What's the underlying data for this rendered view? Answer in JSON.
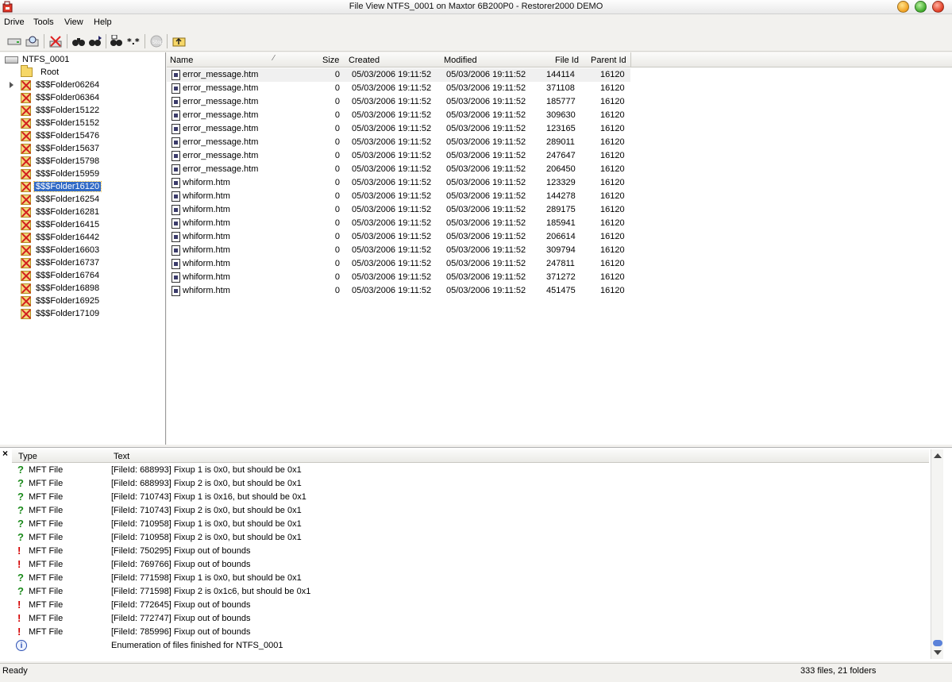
{
  "window": {
    "title": "File View NTFS_0001 on Maxtor 6B200P0 - Restorer2000 DEMO"
  },
  "menu": [
    "Drive",
    "Tools",
    "View",
    "Help"
  ],
  "toolbar": {
    "buttons": [
      "drive-icon",
      "search-scan-icon",
      "disconnect-icon",
      "find-icon",
      "find-next-icon",
      "find-file-icon",
      "mask-icon",
      "stop-icon",
      "up-folder-icon"
    ]
  },
  "tree": {
    "root": "NTFS_0001",
    "root_folder": "Root",
    "selected": "$$$Folder16120",
    "folders": [
      "$$$Folder06264",
      "$$$Folder06364",
      "$$$Folder15122",
      "$$$Folder15152",
      "$$$Folder15476",
      "$$$Folder15637",
      "$$$Folder15798",
      "$$$Folder15959",
      "$$$Folder16120",
      "$$$Folder16254",
      "$$$Folder16281",
      "$$$Folder16415",
      "$$$Folder16442",
      "$$$Folder16603",
      "$$$Folder16737",
      "$$$Folder16764",
      "$$$Folder16898",
      "$$$Folder16925",
      "$$$Folder17109"
    ]
  },
  "files": {
    "columns": {
      "name": "Name",
      "size": "Size",
      "created": "Created",
      "modified": "Modified",
      "file_id": "File Id",
      "parent_id": "Parent Id"
    },
    "rows": [
      {
        "name": "error_message.htm",
        "size": "0",
        "created": "05/03/2006 19:11:52",
        "modified": "05/03/2006 19:11:52",
        "file_id": "144114",
        "parent_id": "16120"
      },
      {
        "name": "error_message.htm",
        "size": "0",
        "created": "05/03/2006 19:11:52",
        "modified": "05/03/2006 19:11:52",
        "file_id": "371108",
        "parent_id": "16120"
      },
      {
        "name": "error_message.htm",
        "size": "0",
        "created": "05/03/2006 19:11:52",
        "modified": "05/03/2006 19:11:52",
        "file_id": "185777",
        "parent_id": "16120"
      },
      {
        "name": "error_message.htm",
        "size": "0",
        "created": "05/03/2006 19:11:52",
        "modified": "05/03/2006 19:11:52",
        "file_id": "309630",
        "parent_id": "16120"
      },
      {
        "name": "error_message.htm",
        "size": "0",
        "created": "05/03/2006 19:11:52",
        "modified": "05/03/2006 19:11:52",
        "file_id": "123165",
        "parent_id": "16120"
      },
      {
        "name": "error_message.htm",
        "size": "0",
        "created": "05/03/2006 19:11:52",
        "modified": "05/03/2006 19:11:52",
        "file_id": "289011",
        "parent_id": "16120"
      },
      {
        "name": "error_message.htm",
        "size": "0",
        "created": "05/03/2006 19:11:52",
        "modified": "05/03/2006 19:11:52",
        "file_id": "247647",
        "parent_id": "16120"
      },
      {
        "name": "error_message.htm",
        "size": "0",
        "created": "05/03/2006 19:11:52",
        "modified": "05/03/2006 19:11:52",
        "file_id": "206450",
        "parent_id": "16120"
      },
      {
        "name": "whiform.htm",
        "size": "0",
        "created": "05/03/2006 19:11:52",
        "modified": "05/03/2006 19:11:52",
        "file_id": "123329",
        "parent_id": "16120"
      },
      {
        "name": "whiform.htm",
        "size": "0",
        "created": "05/03/2006 19:11:52",
        "modified": "05/03/2006 19:11:52",
        "file_id": "144278",
        "parent_id": "16120"
      },
      {
        "name": "whiform.htm",
        "size": "0",
        "created": "05/03/2006 19:11:52",
        "modified": "05/03/2006 19:11:52",
        "file_id": "289175",
        "parent_id": "16120"
      },
      {
        "name": "whiform.htm",
        "size": "0",
        "created": "05/03/2006 19:11:52",
        "modified": "05/03/2006 19:11:52",
        "file_id": "185941",
        "parent_id": "16120"
      },
      {
        "name": "whiform.htm",
        "size": "0",
        "created": "05/03/2006 19:11:52",
        "modified": "05/03/2006 19:11:52",
        "file_id": "206614",
        "parent_id": "16120"
      },
      {
        "name": "whiform.htm",
        "size": "0",
        "created": "05/03/2006 19:11:52",
        "modified": "05/03/2006 19:11:52",
        "file_id": "309794",
        "parent_id": "16120"
      },
      {
        "name": "whiform.htm",
        "size": "0",
        "created": "05/03/2006 19:11:52",
        "modified": "05/03/2006 19:11:52",
        "file_id": "247811",
        "parent_id": "16120"
      },
      {
        "name": "whiform.htm",
        "size": "0",
        "created": "05/03/2006 19:11:52",
        "modified": "05/03/2006 19:11:52",
        "file_id": "371272",
        "parent_id": "16120"
      },
      {
        "name": "whiform.htm",
        "size": "0",
        "created": "05/03/2006 19:11:52",
        "modified": "05/03/2006 19:11:52",
        "file_id": "451475",
        "parent_id": "16120"
      }
    ]
  },
  "log": {
    "columns": {
      "type": "Type",
      "text": "Text"
    },
    "rows": [
      {
        "icon": "question",
        "type": "MFT File",
        "text": "[FileId: 688993] Fixup 1 is 0x0, but should be 0x1"
      },
      {
        "icon": "question",
        "type": "MFT File",
        "text": "[FileId: 688993] Fixup 2 is 0x0, but should be 0x1"
      },
      {
        "icon": "question",
        "type": "MFT File",
        "text": "[FileId: 710743] Fixup 1 is 0x16, but should be 0x1"
      },
      {
        "icon": "question",
        "type": "MFT File",
        "text": "[FileId: 710743] Fixup 2 is 0x0, but should be 0x1"
      },
      {
        "icon": "question",
        "type": "MFT File",
        "text": "[FileId: 710958] Fixup 1 is 0x0, but should be 0x1"
      },
      {
        "icon": "question",
        "type": "MFT File",
        "text": "[FileId: 710958] Fixup 2 is 0x0, but should be 0x1"
      },
      {
        "icon": "warn",
        "type": "MFT File",
        "text": "[FileId: 750295] Fixup out of bounds"
      },
      {
        "icon": "warn",
        "type": "MFT File",
        "text": "[FileId: 769766] Fixup out of bounds"
      },
      {
        "icon": "question",
        "type": "MFT File",
        "text": "[FileId: 771598] Fixup 1 is 0x0, but should be 0x1"
      },
      {
        "icon": "question",
        "type": "MFT File",
        "text": "[FileId: 771598] Fixup 2 is 0x1c6, but should be 0x1"
      },
      {
        "icon": "warn",
        "type": "MFT File",
        "text": "[FileId: 772645] Fixup out of bounds"
      },
      {
        "icon": "warn",
        "type": "MFT File",
        "text": "[FileId: 772747] Fixup out of bounds"
      },
      {
        "icon": "warn",
        "type": "MFT File",
        "text": "[FileId: 785996] Fixup out of bounds"
      },
      {
        "icon": "info",
        "type": "",
        "text": "Enumeration of files finished for NTFS_0001"
      }
    ]
  },
  "status": {
    "left": "Ready",
    "right": "333 files, 21 folders"
  }
}
